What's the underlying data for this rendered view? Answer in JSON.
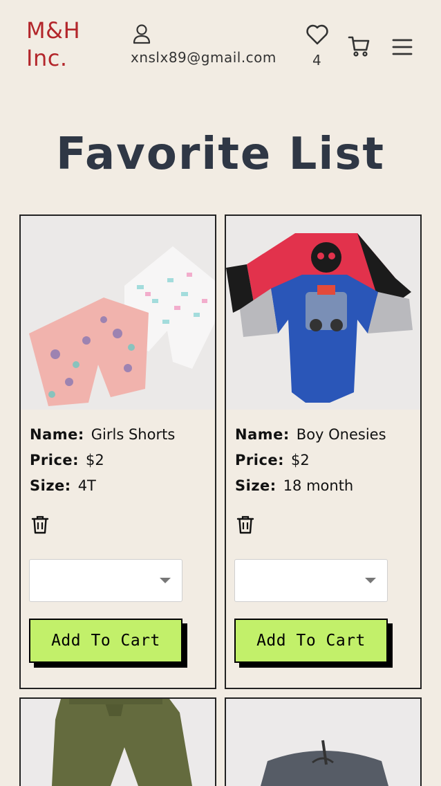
{
  "header": {
    "logo": "M&H Inc.",
    "user_email": "xnslx89@gmail.com",
    "favorites_count": "4",
    "icons": [
      "user-icon",
      "heart-icon",
      "cart-icon",
      "menu-icon"
    ]
  },
  "page": {
    "title": "Favorite List"
  },
  "labels": {
    "name": "Name:",
    "price": "Price:",
    "size": "Size:"
  },
  "products": [
    {
      "name": "Girls Shorts",
      "price": "$2",
      "size": "4T",
      "size_select_value": "",
      "button_label": "Add To Cart"
    },
    {
      "name": "Boy Onesies",
      "price": "$2",
      "size": "18 month",
      "size_select_value": "",
      "button_label": "Add To Cart"
    }
  ],
  "colors": {
    "background": "#f2ece3",
    "logo": "#b3262b",
    "title": "#2f3745",
    "button": "#c2f06a"
  }
}
